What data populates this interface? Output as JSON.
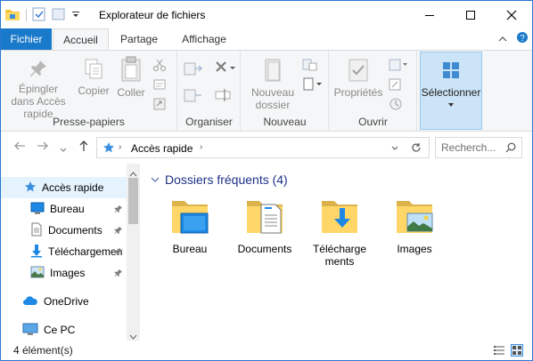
{
  "window": {
    "title": "Explorateur de fichiers",
    "accent": "#1979ca"
  },
  "tabs": [
    {
      "label": "Fichier"
    },
    {
      "label": "Accueil"
    },
    {
      "label": "Partage"
    },
    {
      "label": "Affichage"
    }
  ],
  "ribbon": {
    "pin_label": "Épingler dans Accès rapide",
    "copy_label": "Copier",
    "paste_label": "Coller",
    "group_clipboard": "Presse-papiers",
    "group_organize": "Organiser",
    "new_folder_label": "Nouveau dossier",
    "group_new": "Nouveau",
    "properties_label": "Propriétés",
    "group_open": "Ouvrir",
    "select_label": "Sélectionner"
  },
  "address": {
    "crumb": "Accès rapide"
  },
  "search": {
    "placeholder": "Recherch..."
  },
  "nav": {
    "items": [
      {
        "label": "Accès rapide",
        "icon": "star-icon"
      },
      {
        "label": "Bureau",
        "icon": "desktop-icon"
      },
      {
        "label": "Documents",
        "icon": "documents-icon"
      },
      {
        "label": "Téléchargements",
        "icon": "download-icon"
      },
      {
        "label": "Images",
        "icon": "pictures-icon"
      },
      {
        "label": "OneDrive",
        "icon": "cloud-icon"
      },
      {
        "label": "Ce PC",
        "icon": "computer-icon"
      }
    ]
  },
  "content": {
    "group_header": "Dossiers fréquents (4)",
    "folders": [
      {
        "name": "Bureau",
        "icon": "desktop-folder-icon"
      },
      {
        "name": "Documents",
        "icon": "documents-folder-icon"
      },
      {
        "name_line1": "Télécharge",
        "name_line2": "ments",
        "icon": "downloads-folder-icon"
      },
      {
        "name": "Images",
        "icon": "pictures-folder-icon"
      }
    ]
  },
  "status": {
    "count": "4 élément(s)"
  }
}
